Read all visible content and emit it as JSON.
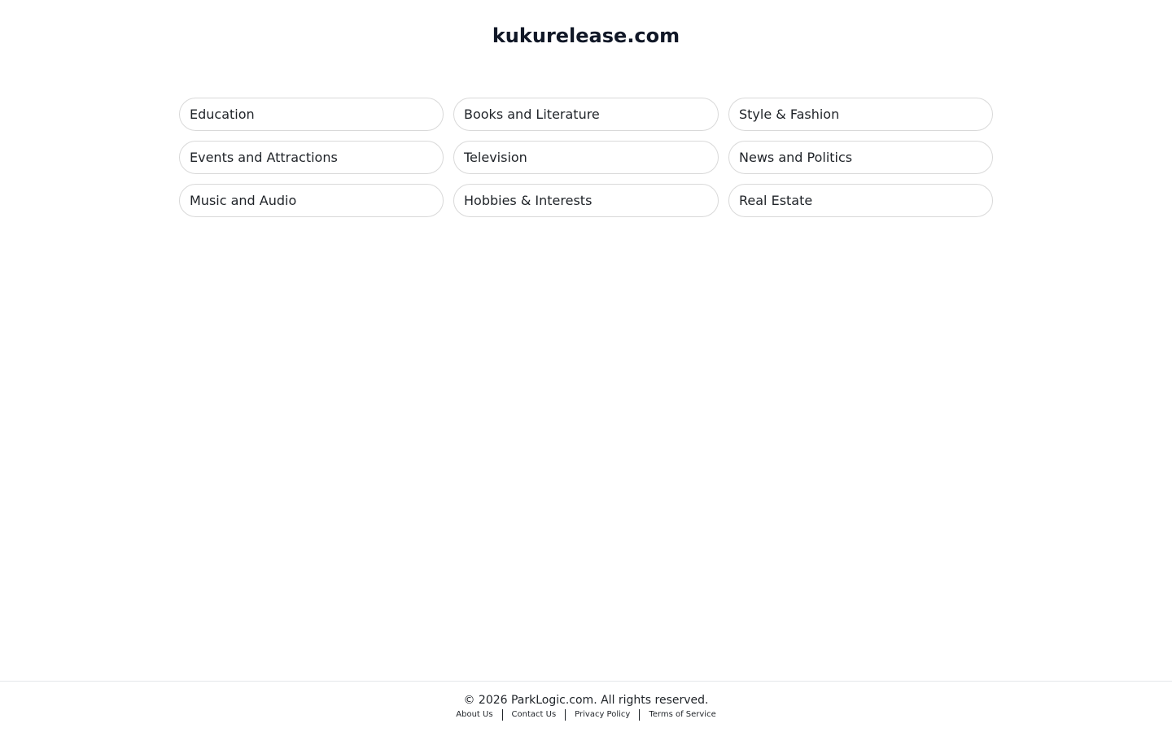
{
  "header": {
    "title": "kukurelease.com"
  },
  "categories": [
    {
      "label": "Education"
    },
    {
      "label": "Books and Literature"
    },
    {
      "label": "Style & Fashion"
    },
    {
      "label": "Events and Attractions"
    },
    {
      "label": "Television"
    },
    {
      "label": "News and Politics"
    },
    {
      "label": "Music and Audio"
    },
    {
      "label": "Hobbies & Interests"
    },
    {
      "label": "Real Estate"
    }
  ],
  "footer": {
    "copyright": "© 2026 ParkLogic.com. All rights reserved.",
    "links": [
      {
        "label": "About Us"
      },
      {
        "label": "Contact Us"
      },
      {
        "label": "Privacy Policy"
      },
      {
        "label": "Terms of Service"
      }
    ]
  }
}
